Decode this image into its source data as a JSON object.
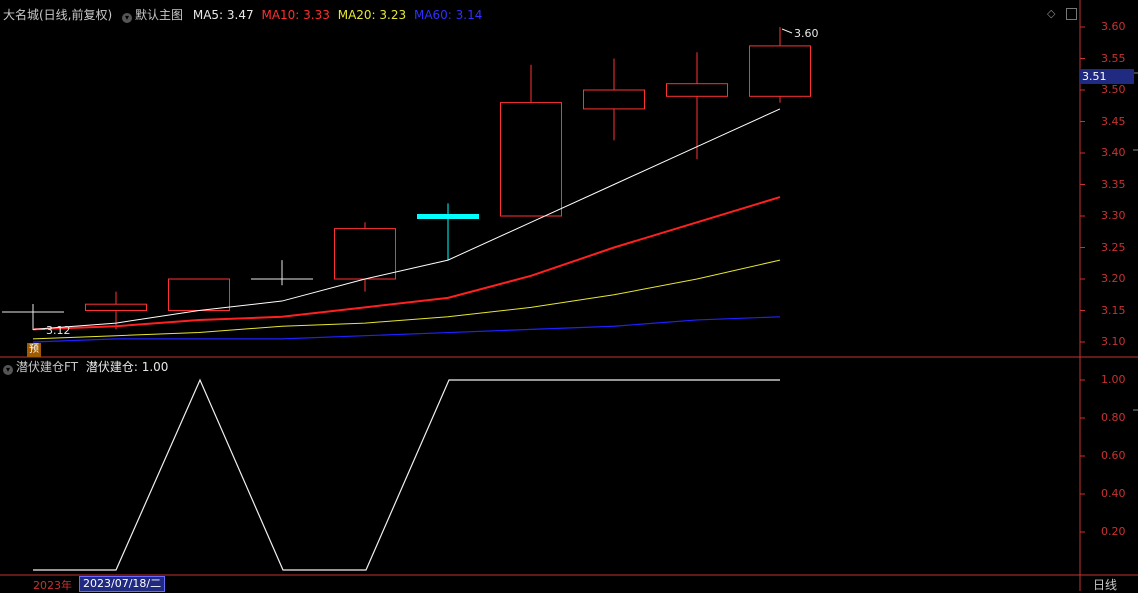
{
  "main_header": {
    "stock": "大名城(日线,前复权)",
    "template": "默认主图",
    "ma5": "MA5: 3.47",
    "ma10": "MA10: 3.33",
    "ma20": "MA20: 3.23",
    "ma60": "MA60: 3.14"
  },
  "indicator_header": {
    "name": "潜伏建仓FT",
    "value": "潜伏建仓: 1.00"
  },
  "current_price": "3.51",
  "high_label": "3.60",
  "low_label": "3.12",
  "pre_badge": "预",
  "price_ticks": [
    "3.60",
    "3.55",
    "3.50",
    "3.45",
    "3.40",
    "3.35",
    "3.30",
    "3.25",
    "3.20",
    "3.15",
    "3.10"
  ],
  "indicator_ticks": [
    "1.00",
    "0.80",
    "0.60",
    "0.40",
    "0.20"
  ],
  "footer": {
    "year": "2023年",
    "date": "2023/07/18/二",
    "period": "日线"
  },
  "colors": {
    "up": "#ff3232",
    "flat": "#00ffff",
    "ma5": "#ffffff",
    "ma10": "#ff2020",
    "ma20": "#e6e632",
    "ma60": "#2020ff",
    "axis": "#c83232"
  },
  "chart_data": {
    "type": "candlestick",
    "candles": [
      {
        "open": 3.14,
        "high": 3.15,
        "low": 3.15,
        "close": 3.14
      },
      {
        "open": 3.15,
        "high": 3.18,
        "low": 3.12,
        "close": 3.16
      },
      {
        "open": 3.15,
        "high": 3.2,
        "low": 3.15,
        "close": 3.2
      },
      {
        "open": 3.2,
        "high": 3.23,
        "low": 3.19,
        "close": 3.2
      },
      {
        "open": 3.2,
        "high": 3.29,
        "low": 3.18,
        "close": 3.28
      },
      {
        "open": 3.3,
        "high": 3.32,
        "low": 3.23,
        "close": 3.3
      },
      {
        "open": 3.3,
        "high": 3.54,
        "low": 3.3,
        "close": 3.48
      },
      {
        "open": 3.47,
        "high": 3.55,
        "low": 3.42,
        "close": 3.5
      },
      {
        "open": 3.49,
        "high": 3.56,
        "low": 3.39,
        "close": 3.51
      },
      {
        "open": 3.49,
        "high": 3.6,
        "low": 3.48,
        "close": 3.57
      }
    ],
    "ma5": [
      3.12,
      3.13,
      3.15,
      3.165,
      3.2,
      3.23,
      3.29,
      3.35,
      3.41,
      3.47
    ],
    "ma10": [
      3.12,
      3.125,
      3.135,
      3.14,
      3.155,
      3.17,
      3.205,
      3.25,
      3.29,
      3.33
    ],
    "ma20": [
      3.105,
      3.11,
      3.115,
      3.125,
      3.13,
      3.14,
      3.155,
      3.175,
      3.2,
      3.23
    ],
    "ma60": [
      3.1,
      3.105,
      3.105,
      3.105,
      3.11,
      3.115,
      3.12,
      3.125,
      3.135,
      3.14
    ],
    "indicator": [
      0,
      0,
      1,
      0,
      0,
      1,
      1,
      1,
      1,
      1
    ],
    "price_range": [
      3.08,
      3.62
    ],
    "indicator_range": [
      0,
      1.0
    ]
  }
}
